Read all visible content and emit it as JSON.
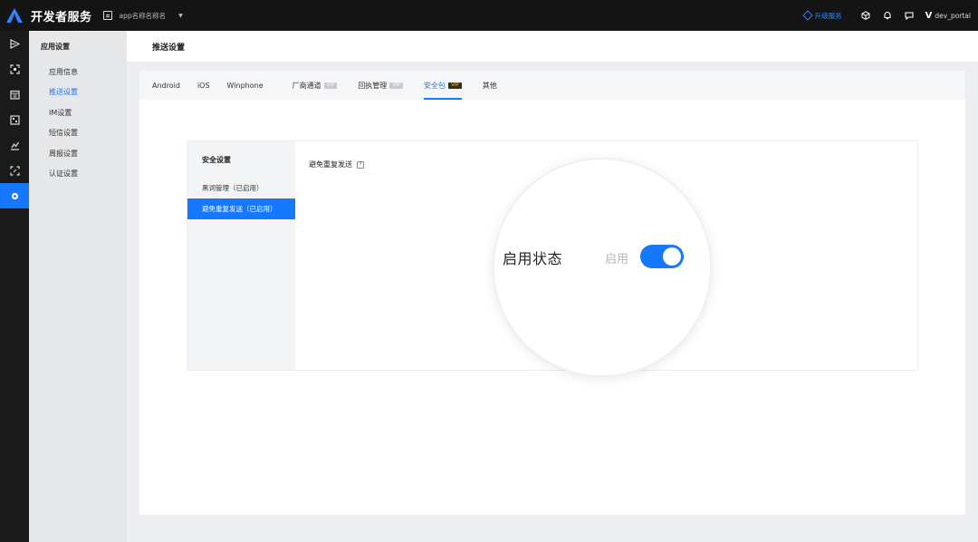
{
  "topbar": {
    "brand": "开发者服务",
    "app_name": "app名称名称名",
    "upgrade_label": "升级服务",
    "user_mark": "V",
    "username": "dev_portal"
  },
  "rail": {
    "items": [
      "play-icon",
      "scan-icon",
      "calendar-icon",
      "qr-icon",
      "chart-icon",
      "frame-icon",
      "settings-icon"
    ],
    "active_index": 6
  },
  "subnav": {
    "title": "应用设置",
    "items": [
      {
        "label": "应用信息"
      },
      {
        "label": "推送设置"
      },
      {
        "label": "IM设置"
      },
      {
        "label": "短信设置"
      },
      {
        "label": "周报设置"
      },
      {
        "label": "认证设置"
      }
    ],
    "active_index": 1
  },
  "header": {
    "title": "推送设置"
  },
  "tabs": [
    {
      "label": "Android"
    },
    {
      "label": "iOS"
    },
    {
      "label": "Winphone"
    },
    {
      "label": "厂商通道",
      "badge": "VIP"
    },
    {
      "label": "回执管理",
      "badge": "VIP"
    },
    {
      "label": "安全包",
      "badge": "VIP"
    },
    {
      "label": "其他"
    }
  ],
  "active_tab": 5,
  "security": {
    "side_title": "安全设置",
    "items": [
      {
        "label": "黑词管理（已启用）"
      },
      {
        "label": "避免重复发送（已启用）"
      }
    ],
    "active_index": 1,
    "section_title": "避免重复发送",
    "help": "?",
    "toggle_label": "启用状态",
    "toggle_status": "启用",
    "toggle_on": true
  },
  "colors": {
    "accent": "#1677ff",
    "topbar_bg": "#141414",
    "rail_bg": "#1a1a1a",
    "vip_gold": "#f1c35c"
  }
}
